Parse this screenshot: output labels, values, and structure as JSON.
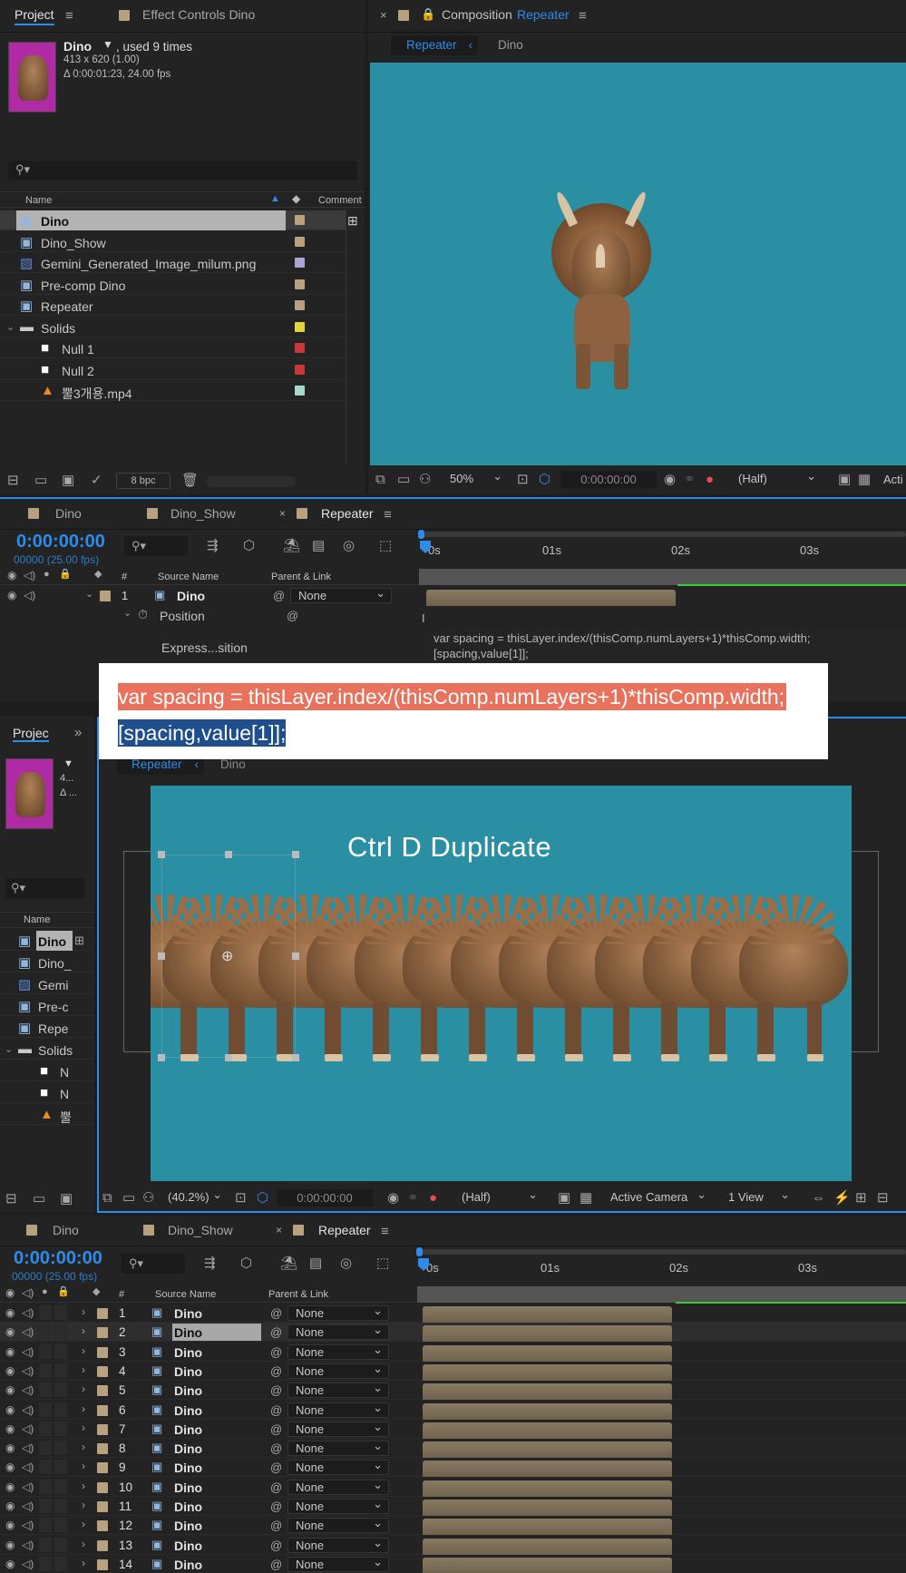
{
  "top": {
    "project": {
      "tab_label": "Project",
      "menu_icon": "hamburger-menu-icon",
      "effect_controls_label": "Effect Controls Dino",
      "preview": {
        "name": "Dino",
        "used": ", used 9 times",
        "dimensions": "413 x 620 (1.00)",
        "duration": "Δ 0:00:01:23, 24.00 fps"
      },
      "search_placeholder": "",
      "columns": {
        "name": "Name",
        "comment": "Comment"
      },
      "items": [
        {
          "name": "Dino",
          "type": "comp",
          "color": "#b7a17f",
          "selected": true
        },
        {
          "name": "Dino_Show",
          "type": "comp",
          "color": "#b7a17f"
        },
        {
          "name": "Gemini_Generated_Image_milum.png",
          "type": "image",
          "color": "#a9a5d8"
        },
        {
          "name": "Pre-comp Dino",
          "type": "comp",
          "color": "#b7a17f"
        },
        {
          "name": "Repeater",
          "type": "comp",
          "color": "#b7a17f"
        },
        {
          "name": "Solids",
          "type": "folder",
          "color": "#e3d43c"
        },
        {
          "name": "Null 1",
          "type": "solid",
          "color": "#c9373a"
        },
        {
          "name": "Null 2",
          "type": "solid",
          "color": "#c9373a"
        },
        {
          "name": "뿔3개용.mp4",
          "type": "video",
          "color": "#a7d8cc"
        }
      ],
      "bpc": "8 bpc"
    },
    "composition": {
      "close": "×",
      "title_prefix": "Composition",
      "title_name": "Repeater",
      "crumbs": [
        "Repeater",
        "Dino"
      ],
      "zoom": "50%",
      "timecode": "0:00:00:00",
      "resolution": "(Half)",
      "cut_label": "Acti",
      "bg_color": "#2a8fa3"
    },
    "timeline": {
      "tabs": [
        "Dino",
        "Dino_Show",
        "Repeater"
      ],
      "timecode": "0:00:00:00",
      "frames": "00000 (25.00 fps)",
      "ruler": [
        "0s",
        "01s",
        "02s",
        "03s"
      ],
      "headers": {
        "num": "#",
        "source": "Source Name",
        "parent": "Parent & Link"
      },
      "layer": {
        "num": "1",
        "name": "Dino",
        "parent": "None"
      },
      "prop_position": "Position",
      "prop_expression": "Express...sition",
      "expression_text_1": "var spacing = thisLayer.index/(thisComp.numLayers+1)*thisComp.width;",
      "expression_text_2": "[spacing,value[1]];"
    }
  },
  "callout": {
    "line1": "var spacing = thisLayer.index/(thisComp.numLayers+1)*thisComp.width;",
    "line2": "[spacing,value[1]];",
    "line1_bg": "#e8725c",
    "line2_bg": "#1f4e8c"
  },
  "bottom": {
    "project": {
      "tab_label": "Projec",
      "preview_dims": "4...",
      "preview_dur": "Δ ...",
      "col_name": "Name",
      "items": [
        {
          "name": "Dino",
          "type": "comp",
          "selected": true
        },
        {
          "name": "Dino_",
          "type": "comp"
        },
        {
          "name": "Gemi",
          "type": "image"
        },
        {
          "name": "Pre-c",
          "type": "comp"
        },
        {
          "name": "Repe",
          "type": "comp"
        },
        {
          "name": "Solids",
          "type": "folder"
        },
        {
          "name": "N",
          "type": "solid"
        },
        {
          "name": "N",
          "type": "solid"
        },
        {
          "name": "뿔",
          "type": "video"
        }
      ]
    },
    "composition": {
      "crumbs": [
        "Repeater",
        "Dino"
      ],
      "overlay_text": "Ctrl D Duplicate",
      "zoom": "(40.2%)",
      "timecode": "0:00:00:00",
      "resolution": "(Half)",
      "camera": "Active Camera",
      "view": "1 View"
    },
    "timeline": {
      "tabs": [
        "Dino",
        "Dino_Show",
        "Repeater"
      ],
      "timecode": "0:00:00:00",
      "frames": "00000 (25.00 fps)",
      "ruler": [
        "0s",
        "01s",
        "02s",
        "03s"
      ],
      "headers": {
        "num": "#",
        "source": "Source Name",
        "parent": "Parent & Link"
      },
      "layers": [
        {
          "num": "1",
          "name": "Dino",
          "parent": "None"
        },
        {
          "num": "2",
          "name": "Dino",
          "parent": "None",
          "selected": true
        },
        {
          "num": "3",
          "name": "Dino",
          "parent": "None"
        },
        {
          "num": "4",
          "name": "Dino",
          "parent": "None"
        },
        {
          "num": "5",
          "name": "Dino",
          "parent": "None"
        },
        {
          "num": "6",
          "name": "Dino",
          "parent": "None"
        },
        {
          "num": "7",
          "name": "Dino",
          "parent": "None"
        },
        {
          "num": "8",
          "name": "Dino",
          "parent": "None"
        },
        {
          "num": "9",
          "name": "Dino",
          "parent": "None"
        },
        {
          "num": "10",
          "name": "Dino",
          "parent": "None"
        },
        {
          "num": "11",
          "name": "Dino",
          "parent": "None"
        },
        {
          "num": "12",
          "name": "Dino",
          "parent": "None"
        },
        {
          "num": "13",
          "name": "Dino",
          "parent": "None"
        },
        {
          "num": "14",
          "name": "Dino",
          "parent": "None"
        }
      ]
    }
  },
  "colors": {
    "accent": "#2d8ceb",
    "panel": "#232323",
    "comp_bg": "#2a8fa3",
    "bar": "#7d6e57"
  }
}
